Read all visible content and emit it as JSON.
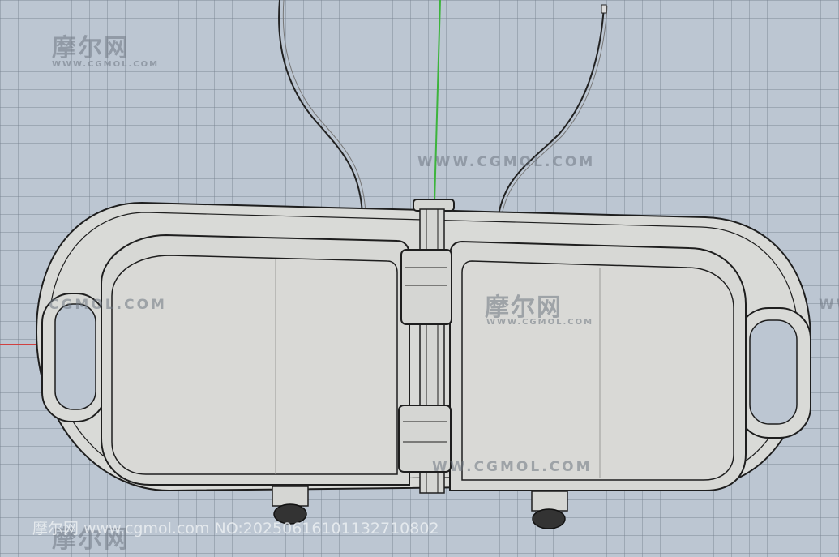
{
  "watermarks": {
    "logo_text": "摩尔网",
    "logo_url": "WWW.CGMOL.COM",
    "line_text_1": "WWW.CGMOL.COM",
    "line_text_2": "CGMOL.COM",
    "line_text_3": "WW.CGMOL.COM",
    "line_text_4": "WW.CGMOL.COM",
    "footer_text": "摩尔网 www.cgmol.com NO:20250616101132710802"
  },
  "colors": {
    "background": "#bcc6d2",
    "grid": "#7a8494",
    "axis_x": "#d04040",
    "axis_y": "#3cb43c",
    "model_fill": "#d8d9d6",
    "model_edge": "#1e1e1e"
  },
  "icons": {
    "y_axis": "green-axis-line",
    "x_axis": "red-axis-line"
  }
}
